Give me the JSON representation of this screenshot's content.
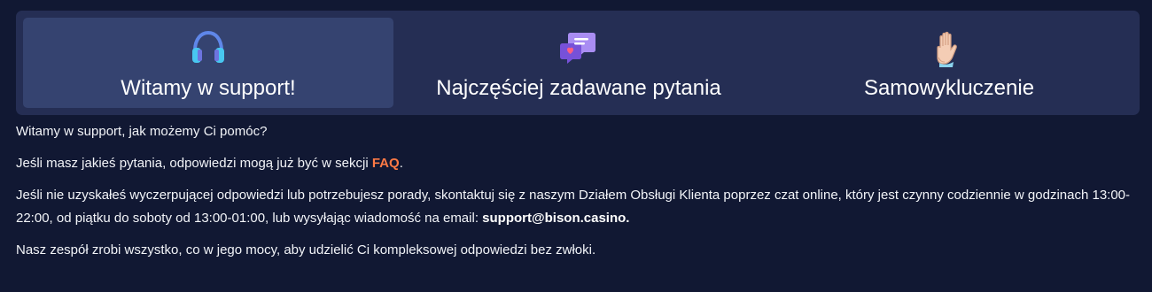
{
  "colors": {
    "background": "#111833",
    "panel": "#252e54",
    "active_tab": "#354370",
    "link": "#ff7a45"
  },
  "tabs": [
    {
      "label": "Witamy w support!",
      "icon": "headphones-icon",
      "active": true
    },
    {
      "label": "Najczęściej zadawane pytania",
      "icon": "chat-bubbles-icon",
      "active": false
    },
    {
      "label": "Samowykluczenie",
      "icon": "raised-hand-icon",
      "active": false
    }
  ],
  "content": {
    "greeting": "Witamy w support, jak możemy Ci pomóc?",
    "faq_prefix": "Jeśli masz jakieś pytania, odpowiedzi mogą już być w sekcji ",
    "faq_link": "FAQ",
    "faq_suffix": ".",
    "contact_text": "Jeśli nie uzyskałeś wyczerpującej odpowiedzi lub potrzebujesz porady, skontaktuj się z naszym Działem Obsługi Klienta poprzez czat online, który jest czynny codziennie w godzinach 13:00-22:00, od piątku do soboty od 13:00-01:00, lub wysyłając wiadomość na email: ",
    "email": "support@bison.casino.",
    "closing": "Nasz zespół zrobi wszystko, co w jego mocy, aby udzielić Ci kompleksowej odpowiedzi bez zwłoki."
  }
}
